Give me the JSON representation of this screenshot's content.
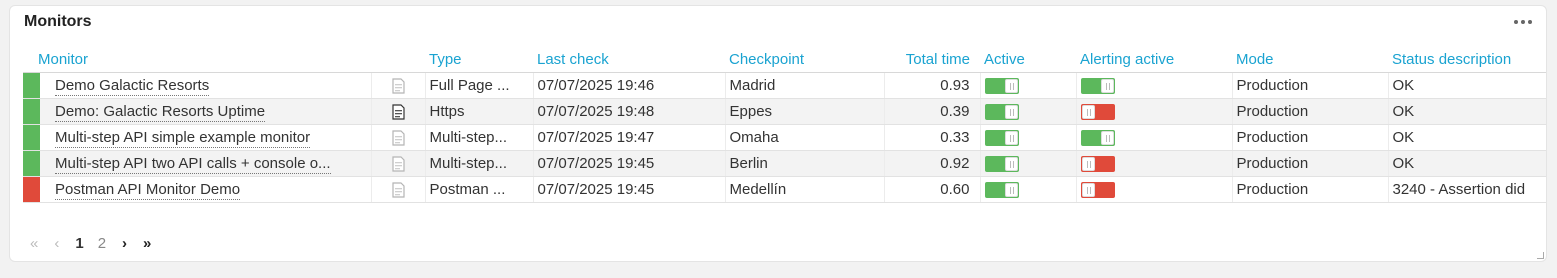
{
  "widget": {
    "title": "Monitors"
  },
  "columns": {
    "monitor": "Monitor",
    "type": "Type",
    "last_check": "Last check",
    "checkpoint": "Checkpoint",
    "total_time": "Total time",
    "active": "Active",
    "alerting_active": "Alerting active",
    "mode": "Mode",
    "status_description": "Status description"
  },
  "rows": [
    {
      "status_color": "#5cb85c",
      "name": "Demo Galactic Resorts",
      "doc_icon": "document-icon-light",
      "type": "Full Page ...",
      "last_check": "07/07/2025 19:46",
      "checkpoint": "Madrid",
      "total_time": "0.93",
      "active": true,
      "alerting_active": true,
      "mode": "Production",
      "status_description": "OK"
    },
    {
      "status_color": "#5cb85c",
      "name": "Demo: Galactic Resorts Uptime",
      "doc_icon": "document-icon-dark",
      "type": "Https",
      "last_check": "07/07/2025 19:48",
      "checkpoint": "Eppes",
      "total_time": "0.39",
      "active": true,
      "alerting_active": false,
      "mode": "Production",
      "status_description": "OK"
    },
    {
      "status_color": "#5cb85c",
      "name": "Multi-step API simple example monitor",
      "doc_icon": "document-icon-light",
      "type": "Multi-step...",
      "last_check": "07/07/2025 19:47",
      "checkpoint": "Omaha",
      "total_time": "0.33",
      "active": true,
      "alerting_active": true,
      "mode": "Production",
      "status_description": "OK"
    },
    {
      "status_color": "#5cb85c",
      "name": "Multi-step API two API calls + console o...",
      "doc_icon": "document-icon-light",
      "type": "Multi-step...",
      "last_check": "07/07/2025 19:45",
      "checkpoint": "Berlin",
      "total_time": "0.92",
      "active": true,
      "alerting_active": false,
      "mode": "Production",
      "status_description": "OK"
    },
    {
      "status_color": "#e04a3a",
      "name": "Postman API Monitor Demo",
      "doc_icon": "document-icon-light",
      "type": "Postman ...",
      "last_check": "07/07/2025 19:45",
      "checkpoint": "Medellín",
      "total_time": "0.60",
      "active": true,
      "alerting_active": false,
      "mode": "Production",
      "status_description": "3240 - Assertion did"
    }
  ],
  "pager": {
    "first": "«",
    "prev": "‹",
    "pages": [
      "1",
      "2"
    ],
    "current": "1",
    "next": "›",
    "last": "»"
  }
}
